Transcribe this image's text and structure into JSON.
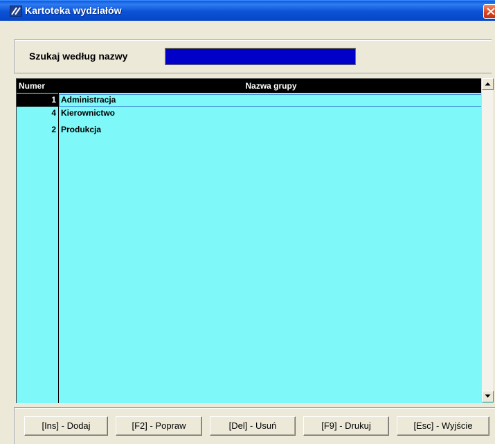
{
  "window": {
    "title": "Kartoteka  wydziałów",
    "icon": "app-logo-icon",
    "close_icon": "close-icon"
  },
  "search": {
    "label": "Szukaj według nazwy",
    "value": "",
    "field_color": "#0000C8"
  },
  "grid": {
    "columns": {
      "number": "Numer",
      "name": "Nazwa grupy"
    },
    "background_color": "#7FF8FA",
    "rows": [
      {
        "number": "1",
        "name": "Administracja",
        "selected": true
      },
      {
        "number": "4",
        "name": "Kierownictwo",
        "selected": false
      },
      {
        "number": "2",
        "name": "Produkcja",
        "selected": false
      }
    ]
  },
  "buttons": {
    "add": "[Ins] - Dodaj",
    "edit": "[F2] - Popraw",
    "delete": "[Del] - Usuń",
    "print": "[F9] - Drukuj",
    "exit": "[Esc] - Wyjście"
  }
}
